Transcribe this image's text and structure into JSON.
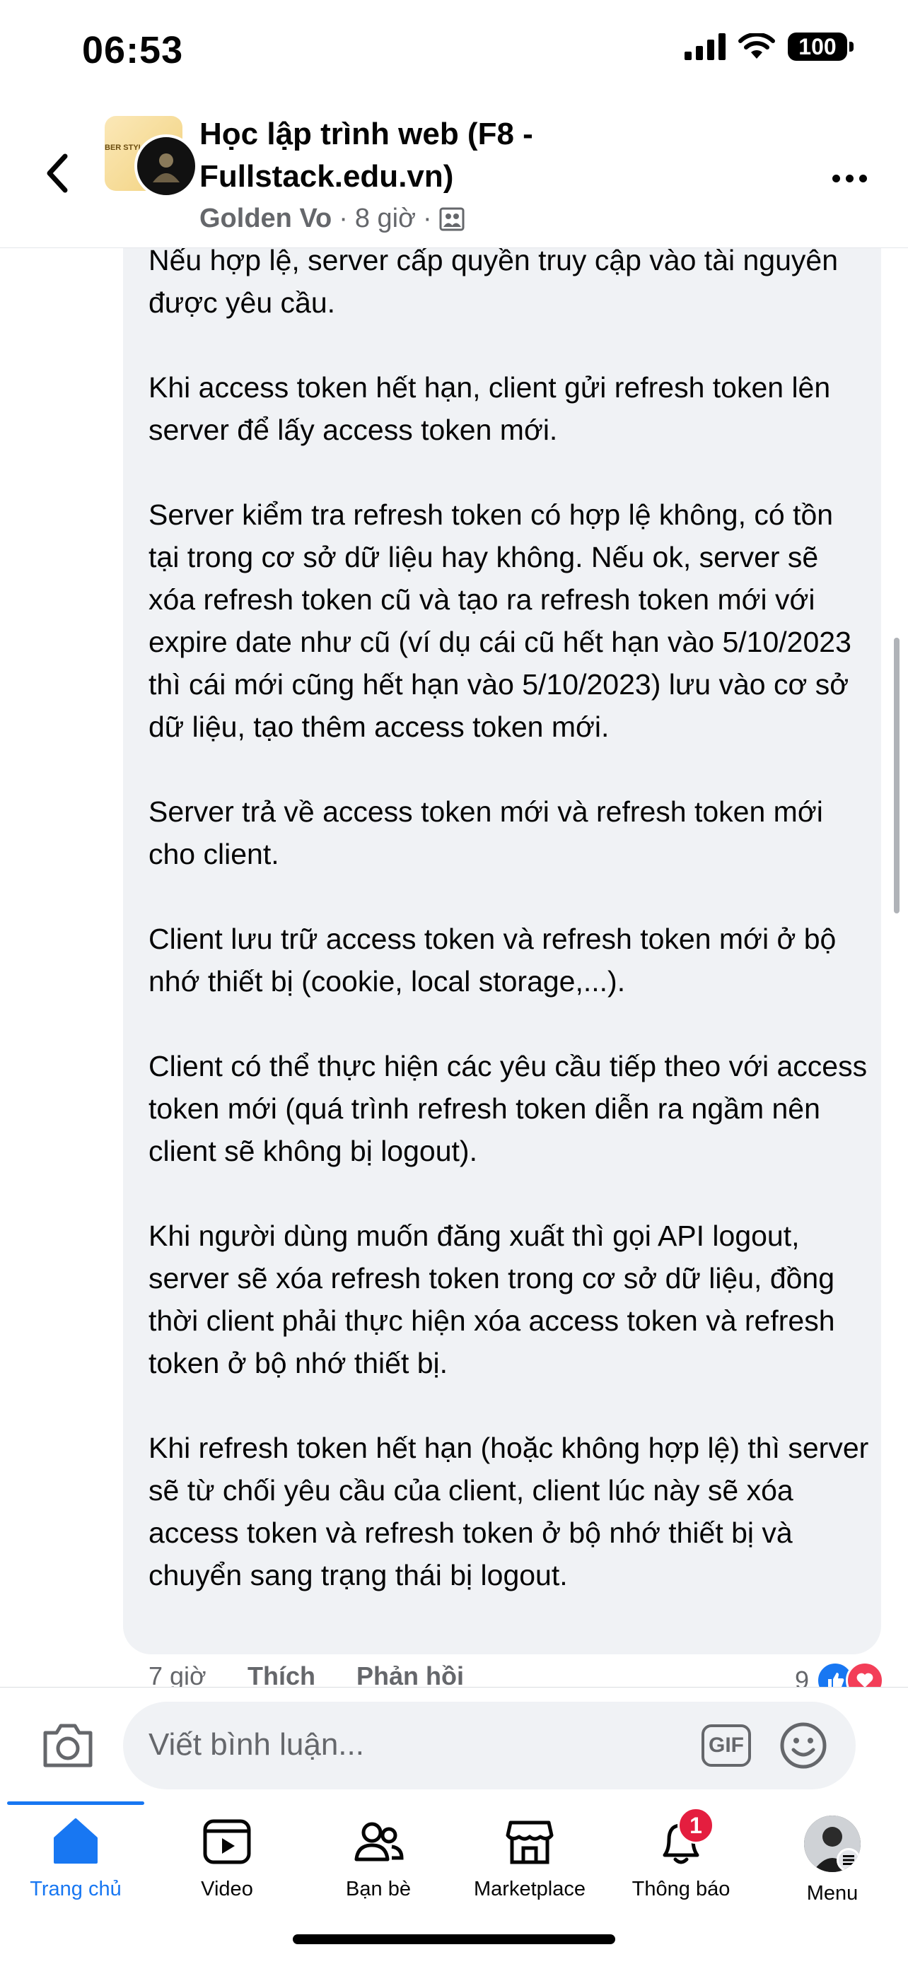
{
  "status_bar": {
    "time": "06:53",
    "battery": "100"
  },
  "header": {
    "group_name": "Học lập trình web (F8 - Fullstack.edu.vn)",
    "author": "Golden Vo",
    "separator1": "·",
    "time_ago": "8 giờ",
    "separator2": "·",
    "avatar_text": "BER STYLE"
  },
  "comment": {
    "paragraphs": [
      "Nếu hợp lệ, server cấp quyền truy cập vào tài nguyên được yêu cầu.",
      "Khi access token hết hạn, client gửi refresh token lên server để lấy access token mới.",
      "Server kiểm tra refresh token có hợp lệ không, có tồn tại trong cơ sở dữ liệu hay không. Nếu ok, server sẽ xóa refresh token cũ và tạo ra refresh token mới với expire date như cũ (ví dụ cái cũ hết hạn vào 5/10/2023 thì cái mới cũng hết hạn vào 5/10/2023) lưu vào cơ sở dữ liệu, tạo thêm access token mới.",
      "Server trả về access token mới và refresh token mới cho client.",
      "Client lưu trữ access token và refresh token mới ở bộ nhớ thiết bị (cookie, local storage,...).",
      "Client có thể thực hiện các yêu cầu tiếp theo với access token mới (quá trình refresh token diễn ra ngầm nên client sẽ không bị logout).",
      "Khi người dùng muốn đăng xuất thì gọi API logout, server sẽ xóa refresh token trong cơ sở dữ liệu, đồng thời client phải thực hiện xóa access token và refresh token ở bộ nhớ thiết bị.",
      "Khi refresh token hết hạn (hoặc không hợp lệ) thì server sẽ từ chối yêu cầu của client, client lúc này sẽ xóa access token và refresh token ở bộ nhớ thiết bị và chuyển sang trạng thái bị logout."
    ],
    "time": "7 giờ",
    "like_label": "Thích",
    "reply_label": "Phản hồi",
    "reaction_count": "9"
  },
  "composer": {
    "placeholder": "Viết bình luận...",
    "gif_label": "GIF"
  },
  "tabs": [
    {
      "label": "Trang chủ",
      "icon": "home-icon"
    },
    {
      "label": "Video",
      "icon": "video-icon"
    },
    {
      "label": "Bạn bè",
      "icon": "friends-icon"
    },
    {
      "label": "Marketplace",
      "icon": "marketplace-icon"
    },
    {
      "label": "Thông báo",
      "icon": "bell-icon",
      "badge": "1"
    },
    {
      "label": "Menu",
      "icon": "menu-avatar"
    }
  ],
  "colors": {
    "accent": "#1877f2",
    "badge": "#e41e3f",
    "bubble": "#f0f2f5",
    "secondary_text": "#65676b"
  }
}
